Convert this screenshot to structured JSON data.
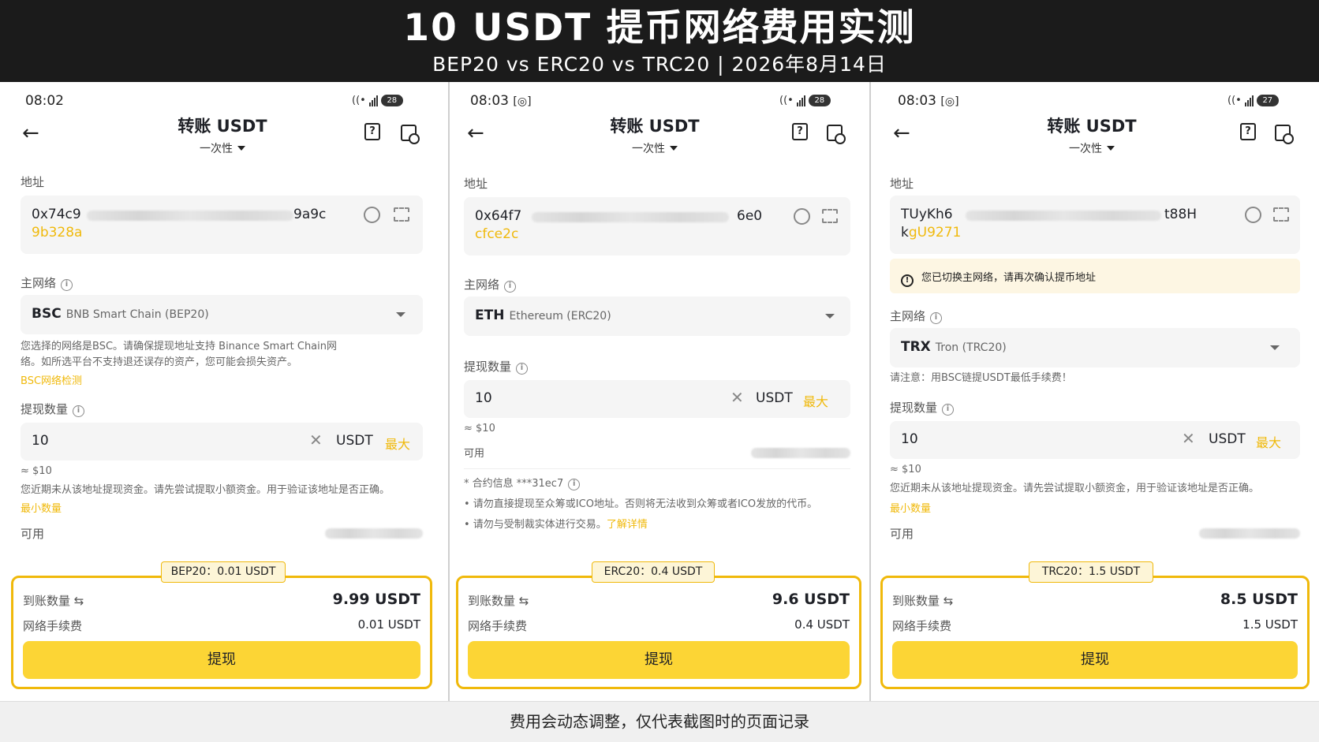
{
  "banner": {
    "title": "10 USDT 提币网络费用实测",
    "subtitle": "BEP20 vs ERC20 vs TRC20 | 2026年8月14日"
  },
  "footer": {
    "note": "费用会动态调整，仅代表截图时的页面记录"
  },
  "colors": {
    "accent": "#f0b90b",
    "button": "#fcd535",
    "banner_bg": "#1b1b1b"
  },
  "panels": [
    {
      "time": "08:02",
      "battery": "28",
      "nav": {
        "title": "转账 USDT",
        "mode": "一次性"
      },
      "address_label": "地址",
      "address_start": "0x74c9",
      "address_end": "9a9c",
      "address_tail": "9b328a",
      "network_label": "主网络",
      "network_code": "BSC",
      "network_name": "BNB Smart Chain (BEP20)",
      "network_note_1": "您选择的网络是BSC。请确保提现地址支持 Binance Smart Chain网",
      "network_note_2": "络。如所选平台不支持退还误存的资产，您可能会损失资产。",
      "network_link": "BSC网络检测",
      "amount_label": "提现数量",
      "amount": "10",
      "unit": "USDT",
      "max": "最大",
      "approx": "≈ $10",
      "notice": "您近期未从该地址提现资金。请先尝试提取小额资金。用于验证该地址是否正确。",
      "min_link": "最小数量",
      "available_label": "可用",
      "fee_tag": "BEP20：0.01 USDT",
      "receive_label": "到账数量",
      "receive_value": "9.99 USDT",
      "fee_label": "网络手续费",
      "fee_value": "0.01 USDT",
      "button": "提现"
    },
    {
      "time": "08:03",
      "battery": "28",
      "nav": {
        "title": "转账 USDT",
        "mode": "一次性"
      },
      "address_label": "地址",
      "address_start": "0x64f7",
      "address_end": "6e0",
      "address_tail": "cfce2c",
      "network_label": "主网络",
      "network_code": "ETH",
      "network_name": "Ethereum (ERC20)",
      "amount_label": "提现数量",
      "amount": "10",
      "unit": "USDT",
      "max": "最大",
      "approx": "≈ $10",
      "available_label": "可用",
      "contract_info": "* 合约信息 ***31ec7",
      "bullet_1": "• 请勿直接提现至众筹或ICO地址。否则将无法收到众筹或者ICO发放的代币。",
      "bullet_2": "• 请勿与受制裁实体进行交易。",
      "learn_more": "了解详情",
      "fee_tag": "ERC20：0.4 USDT",
      "receive_label": "到账数量",
      "receive_value": "9.6 USDT",
      "fee_label": "网络手续费",
      "fee_value": "0.4 USDT",
      "button": "提现"
    },
    {
      "time": "08:03",
      "battery": "27",
      "nav": {
        "title": "转账 USDT",
        "mode": "一次性"
      },
      "address_label": "地址",
      "address_start": "TUyKh6",
      "address_end": "t88H",
      "address_tail_prefix": "k",
      "address_tail": "gU9271",
      "warning": "您已切换主网络，请再次确认提币地址",
      "network_label": "主网络",
      "network_code": "TRX",
      "network_name": "Tron (TRC20)",
      "network_note": "请注意：用BSC链提USDT最低手续费！",
      "amount_label": "提现数量",
      "amount": "10",
      "unit": "USDT",
      "max": "最大",
      "approx": "≈ $10",
      "notice": "您近期未从该地址提现资金。请先尝试提取小额资金，用于验证该地址是否正确。",
      "min_link": "最小数量",
      "available_label": "可用",
      "fee_tag": "TRC20：1.5 USDT",
      "receive_label": "到账数量",
      "receive_value": "8.5 USDT",
      "fee_label": "网络手续费",
      "fee_value": "1.5 USDT",
      "button": "提现"
    }
  ]
}
